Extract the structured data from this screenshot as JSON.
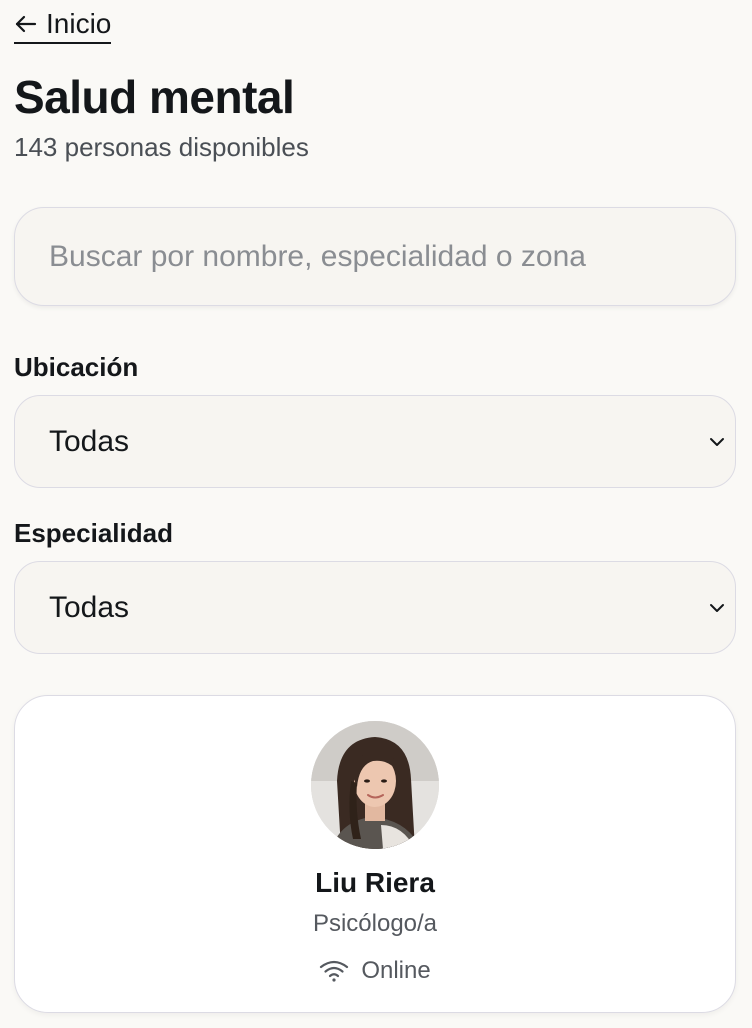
{
  "nav": {
    "back_label": "Inicio"
  },
  "header": {
    "title": "Salud mental",
    "subtitle": "143 personas disponibles"
  },
  "search": {
    "placeholder": "Buscar por nombre, especialidad o zona",
    "value": ""
  },
  "filters": {
    "location": {
      "label": "Ubicación",
      "selected": "Todas"
    },
    "specialty": {
      "label": "Especialidad",
      "selected": "Todas"
    }
  },
  "results": [
    {
      "name": "Liu Riera",
      "role": "Psicólogo/a",
      "mode": "Online",
      "mode_icon": "wifi-icon",
      "avatar_icon": "profile-photo"
    }
  ],
  "colors": {
    "background": "#faf9f6",
    "text": "#14171a",
    "muted": "#55595f",
    "border": "#dcdbe4",
    "card": "#ffffff"
  }
}
